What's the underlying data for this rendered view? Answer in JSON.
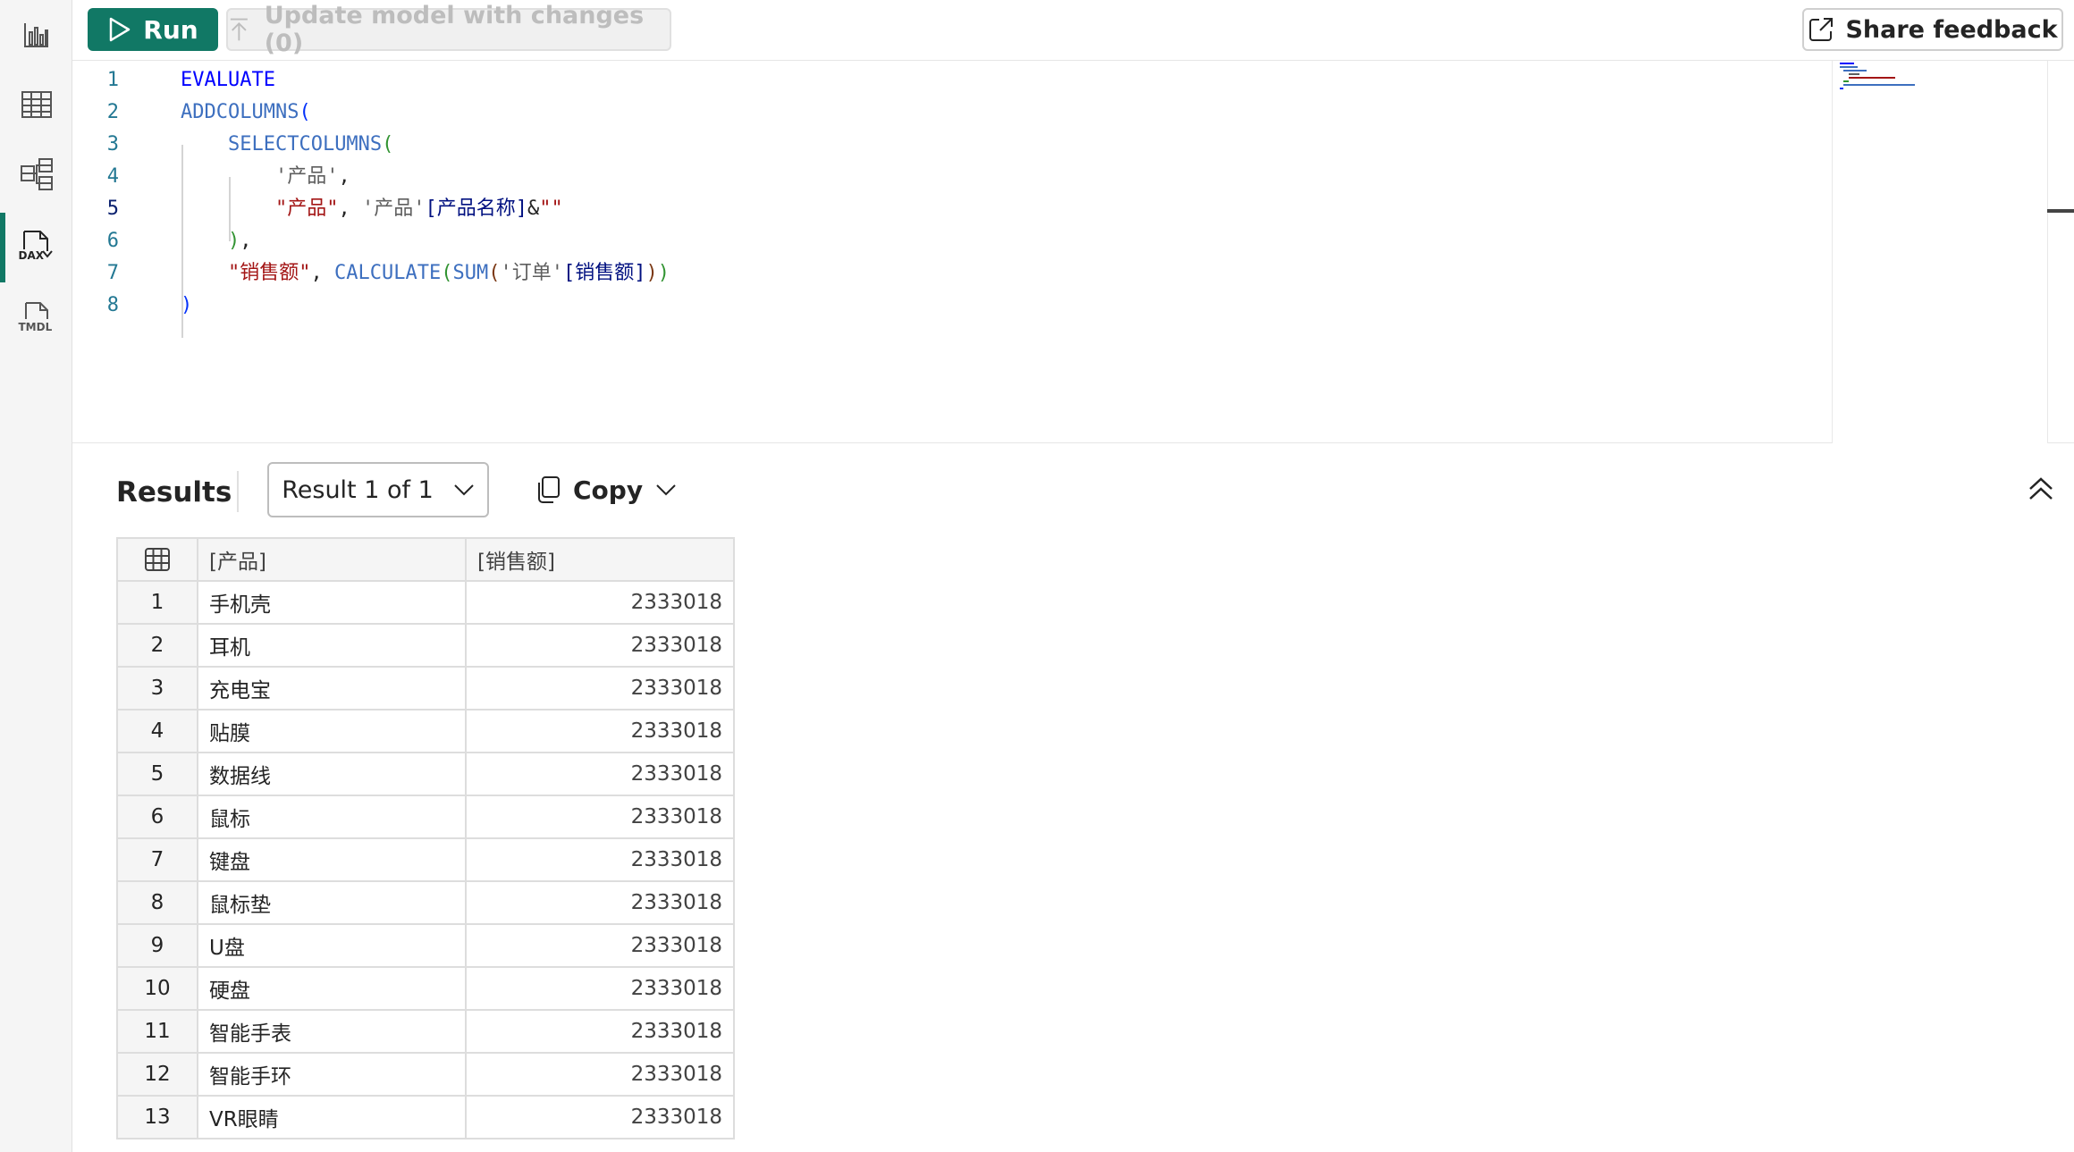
{
  "toolbar": {
    "run_label": "Run",
    "update_label": "Update model with changes (0)",
    "feedback_label": "Share feedback"
  },
  "rail": {
    "items": [
      {
        "icon": "report-view-icon"
      },
      {
        "icon": "table-view-icon"
      },
      {
        "icon": "model-view-icon"
      },
      {
        "icon": "dax-query-view-icon",
        "label": "DAX",
        "active": true
      },
      {
        "icon": "tmdl-view-icon",
        "label": "TMDL"
      }
    ]
  },
  "editor": {
    "line_numbers": [
      "1",
      "2",
      "3",
      "4",
      "5",
      "6",
      "7",
      "8"
    ],
    "current_line": 5,
    "lines": [
      [
        {
          "t": "EVALUATE",
          "c": "kw"
        }
      ],
      [
        {
          "t": "ADDCOLUMNS",
          "c": "fn"
        },
        {
          "t": "(",
          "c": "p1"
        }
      ],
      [
        {
          "t": "    ",
          "c": "plain"
        },
        {
          "t": "SELECTCOLUMNS",
          "c": "fn"
        },
        {
          "t": "(",
          "c": "p2"
        }
      ],
      [
        {
          "t": "        ",
          "c": "plain"
        },
        {
          "t": "'产品'",
          "c": "tbl"
        },
        {
          "t": ",",
          "c": "plain"
        }
      ],
      [
        {
          "t": "        ",
          "c": "plain"
        },
        {
          "t": "\"产品\"",
          "c": "str"
        },
        {
          "t": ", ",
          "c": "plain"
        },
        {
          "t": "'产品'",
          "c": "tbl"
        },
        {
          "t": "[产品名称]",
          "c": "col"
        },
        {
          "t": "&",
          "c": "plain"
        },
        {
          "t": "\"\"",
          "c": "str"
        }
      ],
      [
        {
          "t": "    ",
          "c": "plain"
        },
        {
          "t": ")",
          "c": "p2"
        },
        {
          "t": ",",
          "c": "plain"
        }
      ],
      [
        {
          "t": "    ",
          "c": "plain"
        },
        {
          "t": "\"销售额\"",
          "c": "str"
        },
        {
          "t": ", ",
          "c": "plain"
        },
        {
          "t": "CALCULATE",
          "c": "fn"
        },
        {
          "t": "(",
          "c": "p2"
        },
        {
          "t": "SUM",
          "c": "fn"
        },
        {
          "t": "(",
          "c": "p3"
        },
        {
          "t": "'订单'",
          "c": "tbl"
        },
        {
          "t": "[销售额]",
          "c": "col"
        },
        {
          "t": ")",
          "c": "p3"
        },
        {
          "t": ")",
          "c": "p2"
        }
      ],
      [
        {
          "t": ")",
          "c": "p1"
        }
      ]
    ]
  },
  "results": {
    "title": "Results",
    "selector_label": "Result 1 of 1",
    "copy_label": "Copy",
    "columns": [
      "[产品]",
      "[销售额]"
    ],
    "rows": [
      {
        "n": "1",
        "name": "手机壳",
        "value": "2333018"
      },
      {
        "n": "2",
        "name": "耳机",
        "value": "2333018"
      },
      {
        "n": "3",
        "name": "充电宝",
        "value": "2333018"
      },
      {
        "n": "4",
        "name": "贴膜",
        "value": "2333018"
      },
      {
        "n": "5",
        "name": "数据线",
        "value": "2333018"
      },
      {
        "n": "6",
        "name": "鼠标",
        "value": "2333018"
      },
      {
        "n": "7",
        "name": "键盘",
        "value": "2333018"
      },
      {
        "n": "8",
        "name": "鼠标垫",
        "value": "2333018"
      },
      {
        "n": "9",
        "name": "U盘",
        "value": "2333018"
      },
      {
        "n": "10",
        "name": "硬盘",
        "value": "2333018"
      },
      {
        "n": "11",
        "name": "智能手表",
        "value": "2333018"
      },
      {
        "n": "12",
        "name": "智能手环",
        "value": "2333018"
      },
      {
        "n": "13",
        "name": "VR眼睛",
        "value": "2333018"
      }
    ]
  },
  "colors": {
    "accent": "#117865",
    "keyword": "#0000ff",
    "function": "#3d6fbf",
    "string": "#a31515",
    "column": "#001080"
  }
}
